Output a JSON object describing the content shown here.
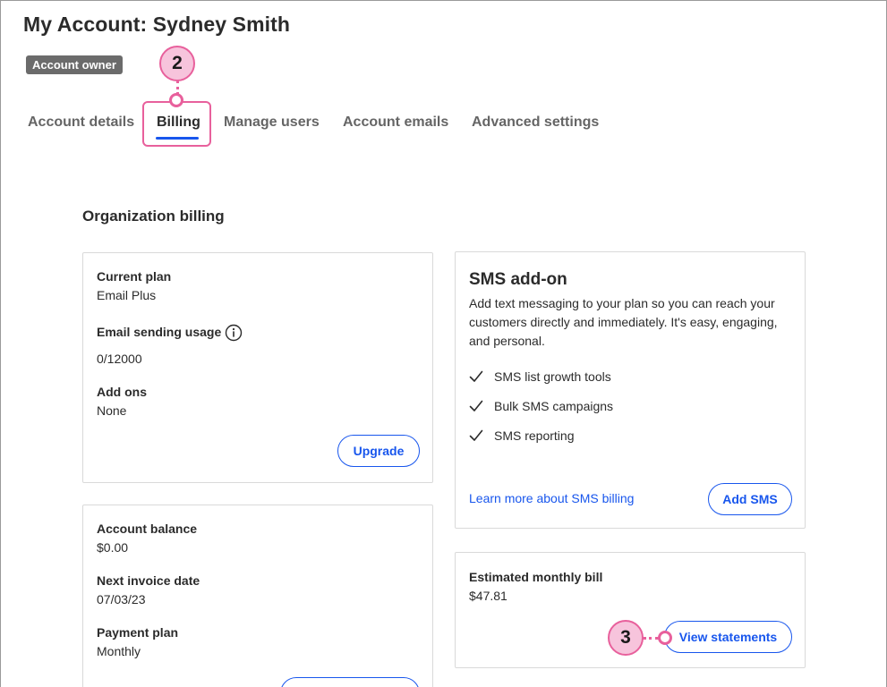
{
  "header": {
    "title": "My Account: Sydney Smith",
    "badge": "Account owner"
  },
  "tabs": [
    {
      "label": "Account details",
      "active": false
    },
    {
      "label": "Billing",
      "active": true
    },
    {
      "label": "Manage users",
      "active": false
    },
    {
      "label": "Account emails",
      "active": false
    },
    {
      "label": "Advanced settings",
      "active": false
    }
  ],
  "callouts": {
    "billing_step": "2",
    "statements_step": "3"
  },
  "section": {
    "title": "Organization billing"
  },
  "plan_card": {
    "current_plan_label": "Current plan",
    "current_plan_value": "Email Plus",
    "usage_label": "Email sending usage",
    "usage_value": "0/12000",
    "addons_label": "Add ons",
    "addons_value": "None",
    "upgrade_label": "Upgrade"
  },
  "balance_card": {
    "balance_label": "Account balance",
    "balance_value": "$0.00",
    "invoice_label": "Next invoice date",
    "invoice_value": "07/03/23",
    "payment_label": "Payment plan",
    "payment_value": "Monthly"
  },
  "sms_card": {
    "title": "SMS add-on",
    "description": "Add text messaging to your plan so you can reach your customers directly and immediately. It's easy, engaging, and personal.",
    "features": [
      "SMS list growth tools",
      "Bulk SMS campaigns",
      "SMS reporting"
    ],
    "learn_more_label": "Learn more about SMS billing",
    "add_sms_label": "Add SMS"
  },
  "bill_card": {
    "label": "Estimated monthly bill",
    "value": "$47.81",
    "view_statements_label": "View statements"
  },
  "colors": {
    "accent": "#1856ed",
    "callout": "#e8609c",
    "callout_fill": "#f7c4dc",
    "badge": "#6b6b6b"
  },
  "icons": [
    "info-icon",
    "checkmark-icon"
  ]
}
